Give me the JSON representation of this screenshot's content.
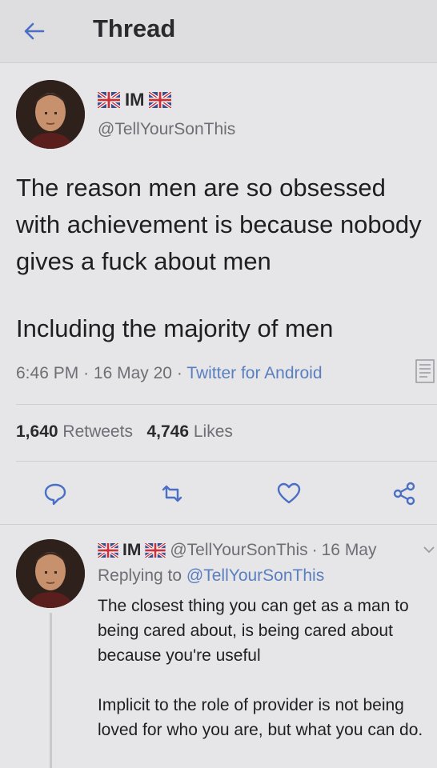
{
  "header": {
    "title": "Thread",
    "back_icon": "arrow-left-icon"
  },
  "main_tweet": {
    "display_name": "IM",
    "flag_icon": "uk-flag-icon",
    "handle": "@TellYourSonThis",
    "paragraph_1": "The reason men are so obsessed with achievement is because nobody gives a fuck about men",
    "paragraph_2": "Including the majority of men",
    "time": "6:46 PM",
    "date": "16 May 20",
    "source": "Twitter for Android",
    "separator": "·",
    "retweets_count": "1,640",
    "retweets_label": "Retweets",
    "likes_count": "4,746",
    "likes_label": "Likes",
    "actions": [
      "reply-icon",
      "retweet-icon",
      "like-icon",
      "share-icon"
    ]
  },
  "reply_tweet": {
    "display_name": "IM",
    "handle": "@TellYourSonThis",
    "date": "16 May",
    "separator": "·",
    "replying_prefix": "Replying to",
    "replying_handle": "@TellYourSonThis",
    "paragraph_1": "The closest thing you can get as a man to being cared about, is being cared about because you're useful",
    "paragraph_2": "Implicit to the role of provider is not being loved for who you are, but what you can do."
  },
  "colors": {
    "background": "#e6e5e8",
    "text": "#1f1f22",
    "muted": "#6e6e74",
    "link": "#5a7fbf",
    "accent": "#4a6fc4"
  }
}
